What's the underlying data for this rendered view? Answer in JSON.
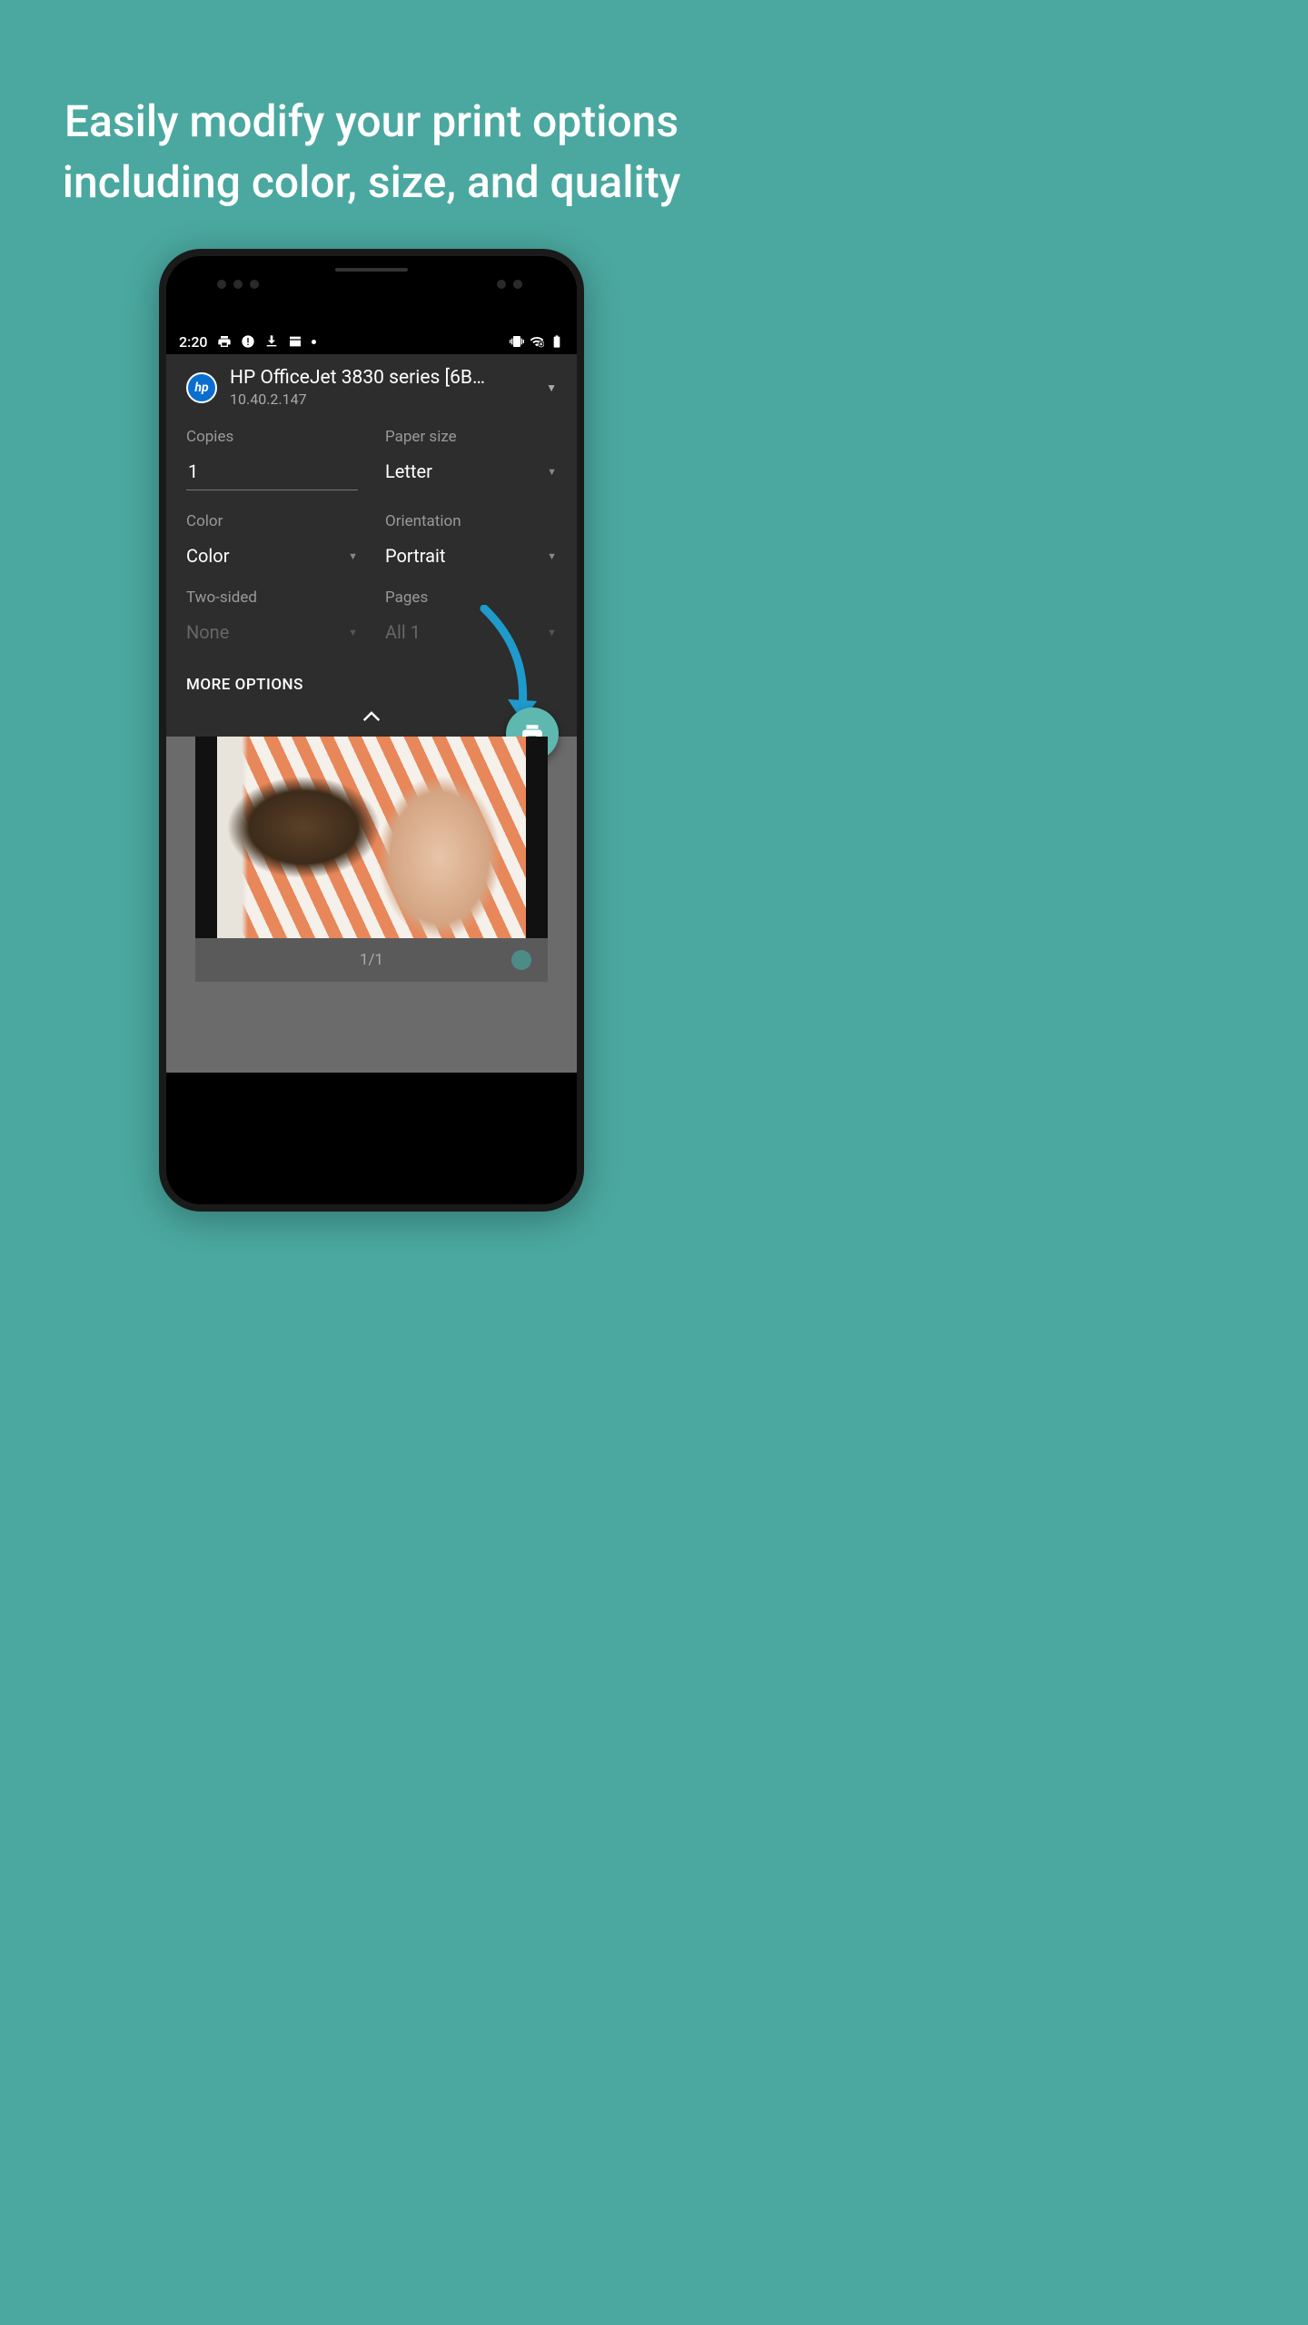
{
  "promo": {
    "title": "Easily modify your print options including color, size, and quality"
  },
  "statusbar": {
    "time": "2:20"
  },
  "printer": {
    "logo_text": "hp",
    "name": "HP OfficeJet 3830 series [6B…",
    "ip": "10.40.2.147"
  },
  "options": {
    "copies": {
      "label": "Copies",
      "value": "1"
    },
    "paper_size": {
      "label": "Paper size",
      "value": "Letter"
    },
    "color": {
      "label": "Color",
      "value": "Color"
    },
    "orientation": {
      "label": "Orientation",
      "value": "Portrait"
    },
    "two_sided": {
      "label": "Two-sided",
      "value": "None"
    },
    "pages": {
      "label": "Pages",
      "value": "All 1"
    }
  },
  "buttons": {
    "more_options": "MORE OPTIONS"
  },
  "preview": {
    "page_indicator": "1/1"
  }
}
